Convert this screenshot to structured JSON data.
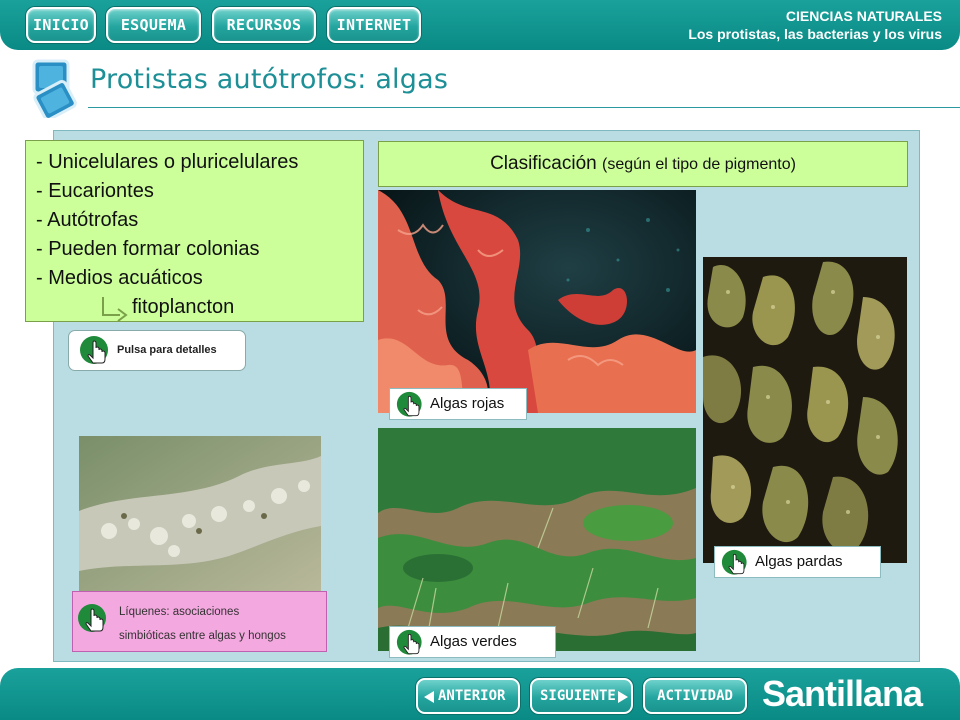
{
  "header": {
    "nav": [
      "INICIO",
      "ESQUEMA",
      "RECURSOS",
      "INTERNET"
    ],
    "subject": "CIENCIAS NATURALES",
    "unit": "Los protistas, las bacterias y los virus"
  },
  "title": "Protistas autótrofos: algas",
  "features": {
    "lines": [
      "- Unicelulares o pluricelulares",
      "- Eucariontes",
      "- Autótrofas",
      "- Pueden formar colonias",
      "- Medios acuáticos"
    ],
    "arrow_item": "fitoplancton"
  },
  "details_button": "Pulsa para detalles",
  "classification": {
    "title": "Clasificación",
    "subtitle": "(según el tipo de pigmento)"
  },
  "algae": {
    "red": "Algas rojas",
    "green": "Algas verdes",
    "brown": "Algas pardas"
  },
  "lichens": {
    "line1": "Líquenes: asociaciones",
    "line2": "simbióticas entre algas y hongos"
  },
  "footer": {
    "prev": "ANTERIOR",
    "next": "SIGUIENTE",
    "activity": "ACTIVIDAD",
    "brand": "Santillana"
  },
  "icons": {
    "hand": "pointer-hand-icon",
    "arrow": "corner-arrow-icon"
  },
  "colors": {
    "teal": "#0a8a85",
    "panel": "#b9dde2",
    "note_green": "#ccff99",
    "lichen_pink": "#f4a8e0"
  }
}
